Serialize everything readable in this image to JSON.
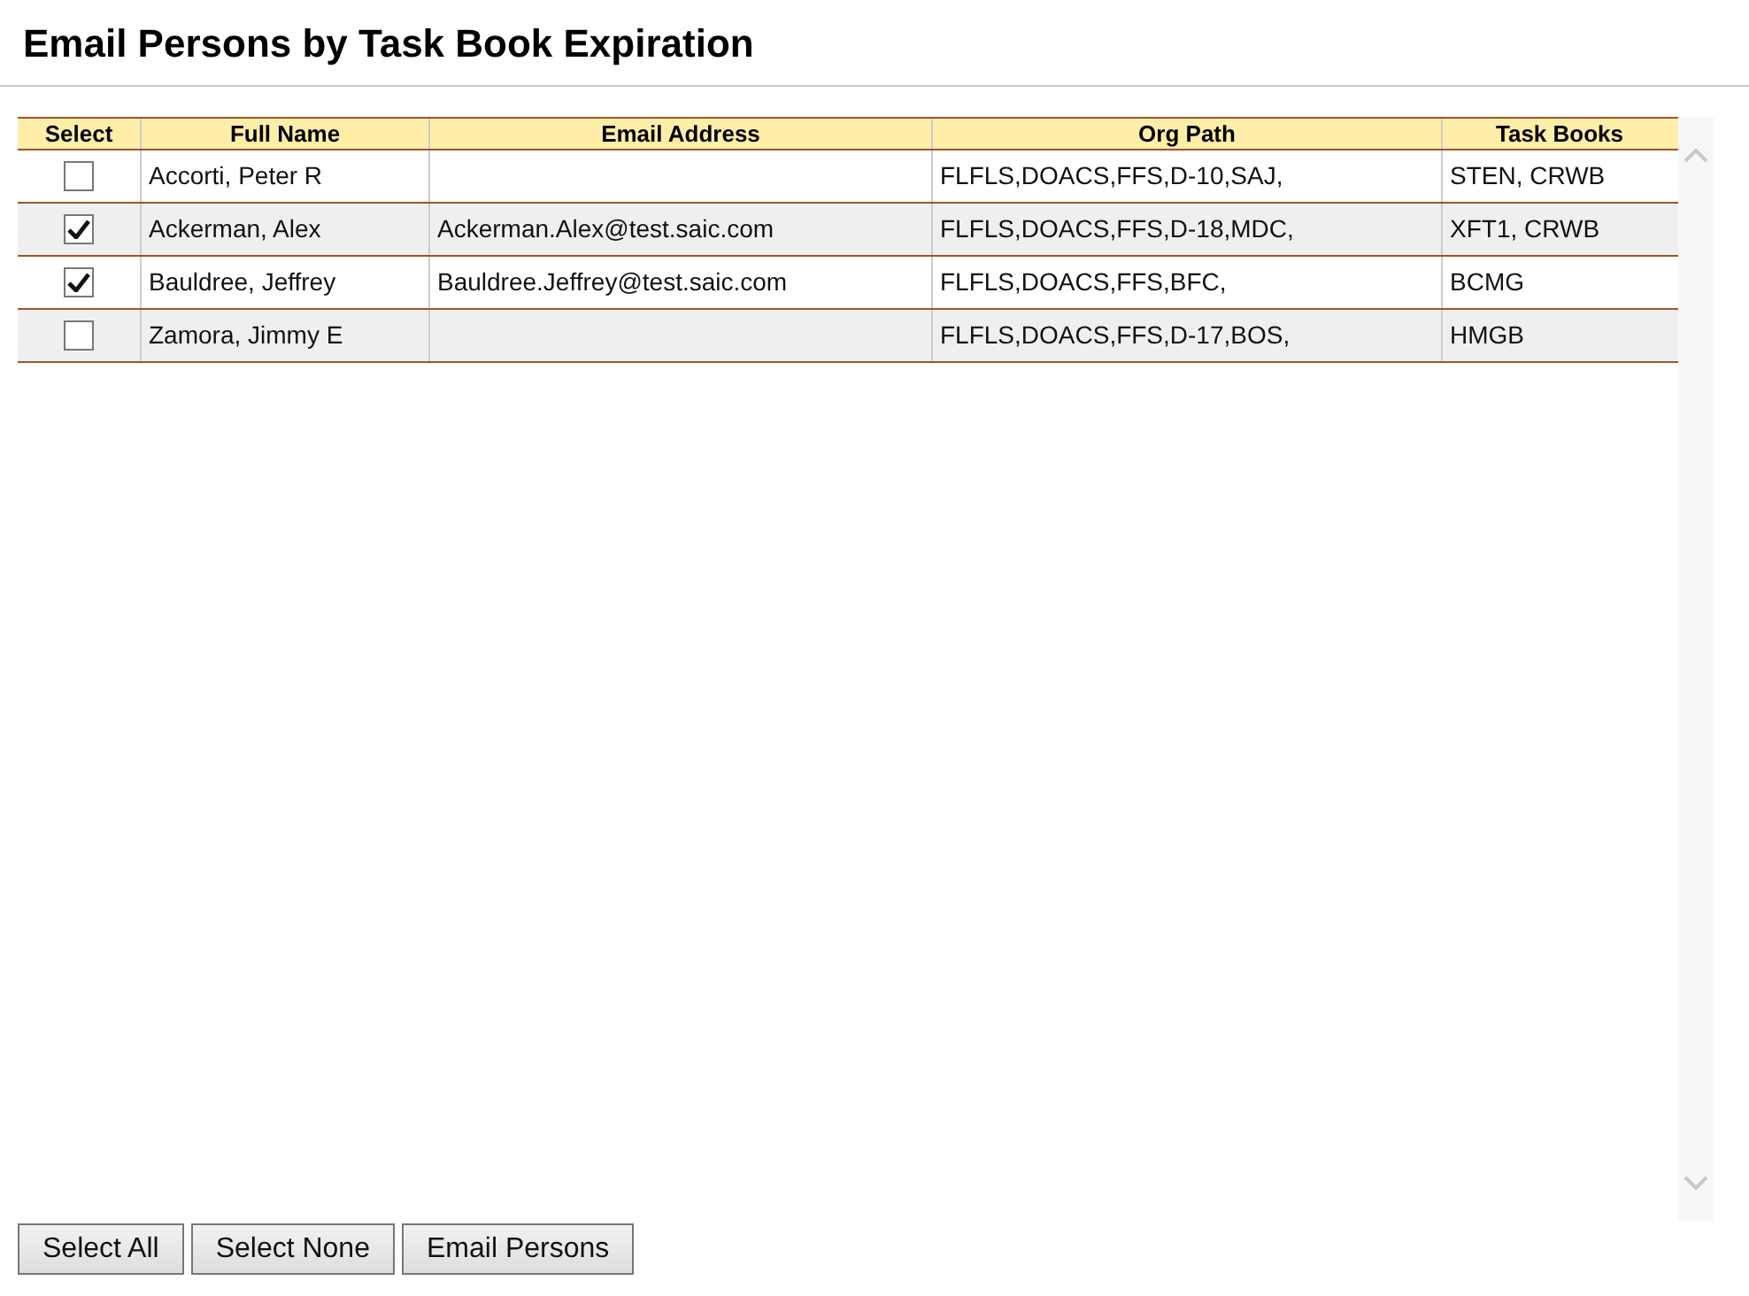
{
  "title": "Email Persons by Task Book Expiration",
  "table": {
    "columns": [
      "Select",
      "Full Name",
      "Email Address",
      "Org Path",
      "Task Books"
    ],
    "rows": [
      {
        "checked": false,
        "full_name": "Accorti, Peter R",
        "email": "",
        "org_path": "FLFLS,DOACS,FFS,D-10,SAJ,",
        "task_books": "STEN, CRWB"
      },
      {
        "checked": true,
        "full_name": "Ackerman, Alex",
        "email": "Ackerman.Alex@test.saic.com",
        "org_path": "FLFLS,DOACS,FFS,D-18,MDC,",
        "task_books": "XFT1, CRWB"
      },
      {
        "checked": true,
        "full_name": "Bauldree, Jeffrey",
        "email": "Bauldree.Jeffrey@test.saic.com",
        "org_path": "FLFLS,DOACS,FFS,BFC,",
        "task_books": "BCMG"
      },
      {
        "checked": false,
        "full_name": "Zamora, Jimmy E",
        "email": "",
        "org_path": "FLFLS,DOACS,FFS,D-17,BOS,",
        "task_books": "HMGB"
      }
    ]
  },
  "buttons": [
    "Select All",
    "Select None",
    "Email Persons"
  ]
}
